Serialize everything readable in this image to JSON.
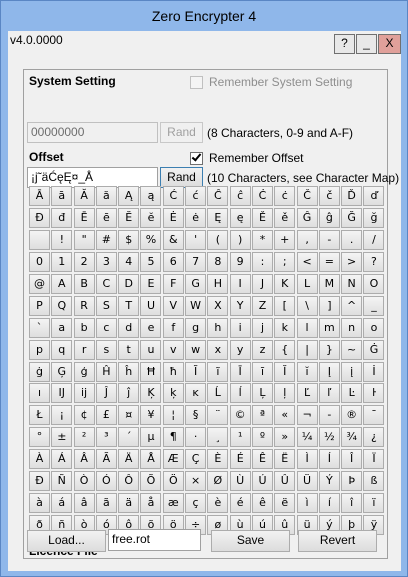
{
  "window": {
    "title": "Zero Encrypter 4",
    "version": "v4.0.0000"
  },
  "titlebar_buttons": {
    "help": "?",
    "minimize": "_",
    "close": "X"
  },
  "system_setting": {
    "heading": "System Setting",
    "value": "00000000",
    "rand_label": "Rand",
    "note": "(8 Characters, 0-9 and A-F)",
    "remember_label": "Remember System Setting",
    "remember_checked": false
  },
  "offset": {
    "heading": "Offset",
    "value": "¡j˜äĆęĘ¤_Å",
    "rand_label": "Rand",
    "note": "(10 Characters, see Character Map)",
    "remember_label": "Remember Offset",
    "remember_checked": true
  },
  "char_map": [
    [
      "Ā",
      "ā",
      "Ă",
      "ă",
      "Ą",
      "ą",
      "Ć",
      "ć",
      "Ĉ",
      "ĉ",
      "Ċ",
      "ċ",
      "Č",
      "č",
      "Ď",
      "ď"
    ],
    [
      "Đ",
      "đ",
      "Ē",
      "ē",
      "Ĕ",
      "ĕ",
      "Ė",
      "ė",
      "Ę",
      "ę",
      "Ě",
      "ě",
      "Ĝ",
      "ĝ",
      "Ğ",
      "ğ"
    ],
    [
      "",
      "!",
      "\"",
      "#",
      "$",
      "%",
      "&",
      "'",
      "(",
      ")",
      "*",
      "+",
      ",",
      "-",
      ".",
      "/"
    ],
    [
      "0",
      "1",
      "2",
      "3",
      "4",
      "5",
      "6",
      "7",
      "8",
      "9",
      ":",
      ";",
      "<",
      "=",
      ">",
      "?"
    ],
    [
      "@",
      "A",
      "B",
      "C",
      "D",
      "E",
      "F",
      "G",
      "H",
      "I",
      "J",
      "K",
      "L",
      "M",
      "N",
      "O"
    ],
    [
      "P",
      "Q",
      "R",
      "S",
      "T",
      "U",
      "V",
      "W",
      "X",
      "Y",
      "Z",
      "[",
      "\\",
      "]",
      "^",
      "_"
    ],
    [
      "`",
      "a",
      "b",
      "c",
      "d",
      "e",
      "f",
      "g",
      "h",
      "i",
      "j",
      "k",
      "l",
      "m",
      "n",
      "o"
    ],
    [
      "p",
      "q",
      "r",
      "s",
      "t",
      "u",
      "v",
      "w",
      "x",
      "y",
      "z",
      "{",
      "|",
      "}",
      "~",
      "Ġ"
    ],
    [
      "ġ",
      "Ģ",
      "ģ",
      "Ĥ",
      "ĥ",
      "Ħ",
      "ħ",
      "Ĩ",
      "ĩ",
      "Ī",
      "ī",
      "Ĭ",
      "ĭ",
      "Į",
      "į",
      "İ"
    ],
    [
      "ı",
      "Ĳ",
      "ĳ",
      "Ĵ",
      "ĵ",
      "Ķ",
      "ķ",
      "ĸ",
      "Ĺ",
      "ĺ",
      "Ļ",
      "ļ",
      "Ľ",
      "ľ",
      "Ŀ",
      "ŀ"
    ],
    [
      "Ł",
      "¡",
      "¢",
      "£",
      "¤",
      "¥",
      "¦",
      "§",
      "¨",
      "©",
      "ª",
      "«",
      "¬",
      "-",
      "®",
      "¯"
    ],
    [
      "°",
      "±",
      "²",
      "³",
      "´",
      "µ",
      "¶",
      "·",
      "¸",
      "¹",
      "º",
      "»",
      "¼",
      "½",
      "¾",
      "¿"
    ],
    [
      "À",
      "Á",
      "Â",
      "Ã",
      "Ä",
      "Å",
      "Æ",
      "Ç",
      "È",
      "É",
      "Ê",
      "Ë",
      "Ì",
      "Í",
      "Î",
      "Ï"
    ],
    [
      "Ð",
      "Ñ",
      "Ò",
      "Ó",
      "Ô",
      "Õ",
      "Ö",
      "×",
      "Ø",
      "Ù",
      "Ú",
      "Û",
      "Ü",
      "Ý",
      "Þ",
      "ß"
    ],
    [
      "à",
      "á",
      "â",
      "ã",
      "ä",
      "å",
      "æ",
      "ç",
      "è",
      "é",
      "ê",
      "ë",
      "ì",
      "í",
      "î",
      "ï"
    ],
    [
      "ð",
      "ñ",
      "ò",
      "ó",
      "ô",
      "õ",
      "ö",
      "÷",
      "ø",
      "ù",
      "ú",
      "û",
      "ü",
      "ý",
      "þ",
      "ÿ"
    ]
  ],
  "licence": {
    "heading": "Licence File",
    "load_label": "Load...",
    "file_value": "free.rot",
    "save_label": "Save",
    "revert_label": "Revert"
  }
}
